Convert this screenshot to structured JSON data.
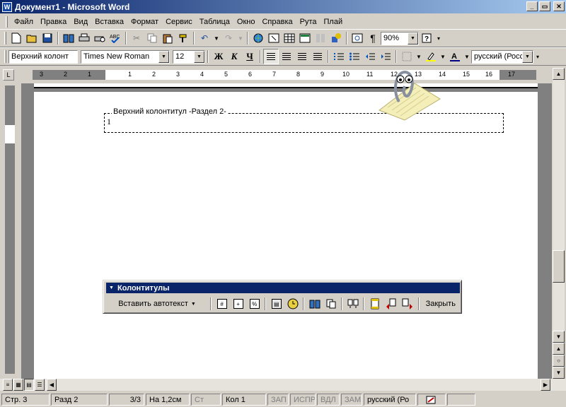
{
  "window": {
    "app_icon": "W",
    "title": "Документ1 - Microsoft Word",
    "minimize": "_",
    "restore": "▭",
    "close": "✕"
  },
  "menu": [
    "Файл",
    "Правка",
    "Вид",
    "Вставка",
    "Формат",
    "Сервис",
    "Таблица",
    "Окно",
    "Справка",
    "Рута",
    "Плай"
  ],
  "standard_toolbar": {
    "zoom": "90%"
  },
  "formatting_toolbar": {
    "style": "Верхний колонт",
    "font": "Times New Roman",
    "size": "12",
    "bold_label": "Ж",
    "italic_label": "К",
    "underline_label": "Ч",
    "language": "русский (Росс"
  },
  "ruler": {
    "numbers": [
      "3",
      "2",
      "1",
      "1",
      "2",
      "3",
      "4",
      "5",
      "6",
      "7",
      "8",
      "9",
      "10",
      "11",
      "12",
      "13",
      "14",
      "15",
      "16",
      "17"
    ]
  },
  "document": {
    "header_label": "Верхний колонтитул -Раздел 2-",
    "header_content": "1"
  },
  "header_footer_toolbar": {
    "title": "Колонтитулы",
    "insert_autotext": "Вставить автотекст",
    "close": "Закрыть"
  },
  "status_bar": {
    "page": "Стр. 3",
    "section": "Разд 2",
    "page_count": "3/3",
    "position": "На 1,2см",
    "line": "Ст",
    "column": "Кол 1",
    "rec": "ЗАП",
    "trk": "ИСПР",
    "ext": "ВДЛ",
    "ovr": "ЗАМ",
    "language": "русский (Ро"
  },
  "colors": {
    "title_start": "#0a246a",
    "title_end": "#a6caf0",
    "chrome": "#d4d0c8",
    "doc_background": "#808080"
  }
}
